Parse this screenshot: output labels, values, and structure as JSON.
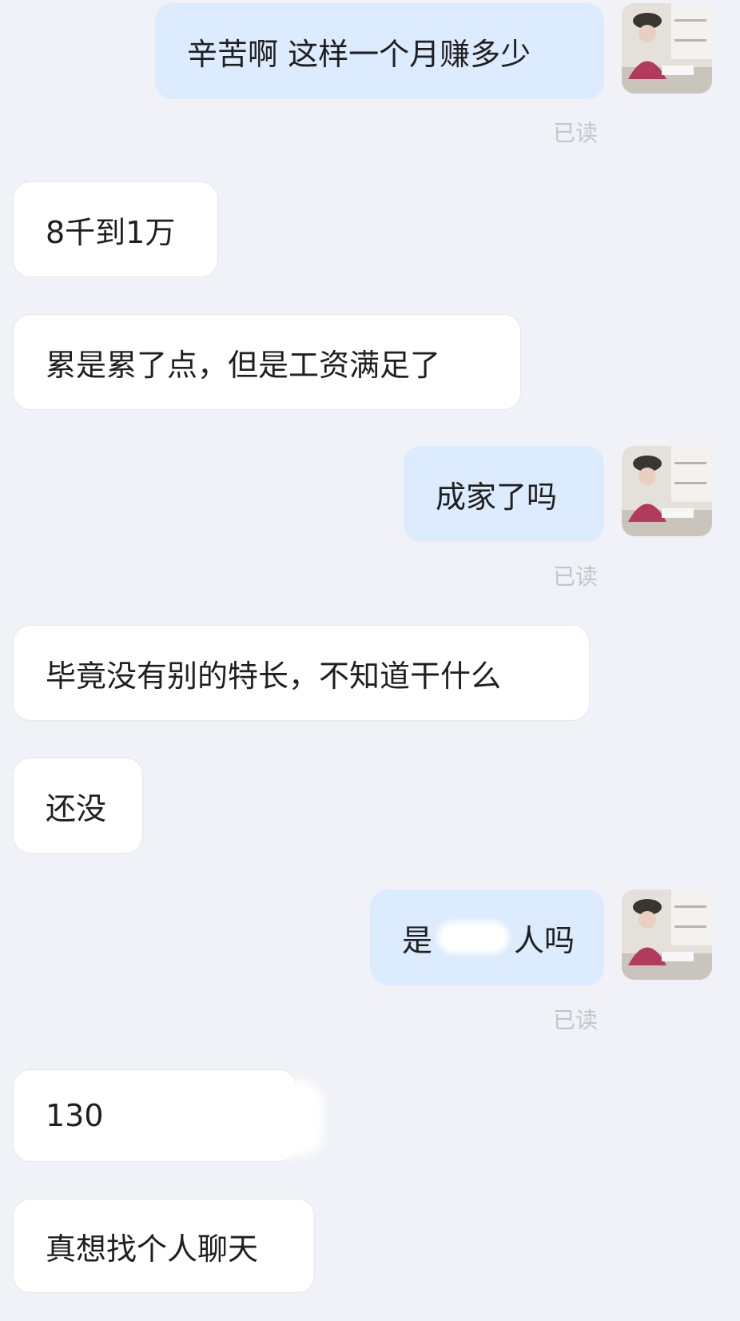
{
  "messages": [
    {
      "side": "out",
      "text": "辛苦啊 这样一个月赚多少",
      "status": "已读"
    },
    {
      "side": "in",
      "text": "8千到1万"
    },
    {
      "side": "in",
      "text": "累是累了点，但是工资满足了"
    },
    {
      "side": "out",
      "text": "成家了吗",
      "status": "已读"
    },
    {
      "side": "in",
      "text": "毕竟没有别的特长，不知道干什么"
    },
    {
      "side": "in",
      "text": "还没"
    },
    {
      "side": "out",
      "text": "是",
      "text_tail": "人吗",
      "status": "已读"
    },
    {
      "side": "in",
      "text": "130"
    },
    {
      "side": "in",
      "text": "真想找个人聊天"
    }
  ],
  "colors": {
    "background": "#f1f2f7",
    "incoming_bubble": "#ffffff",
    "outgoing_bubble": "#dcebfd",
    "read_status": "#c4c5c9"
  }
}
